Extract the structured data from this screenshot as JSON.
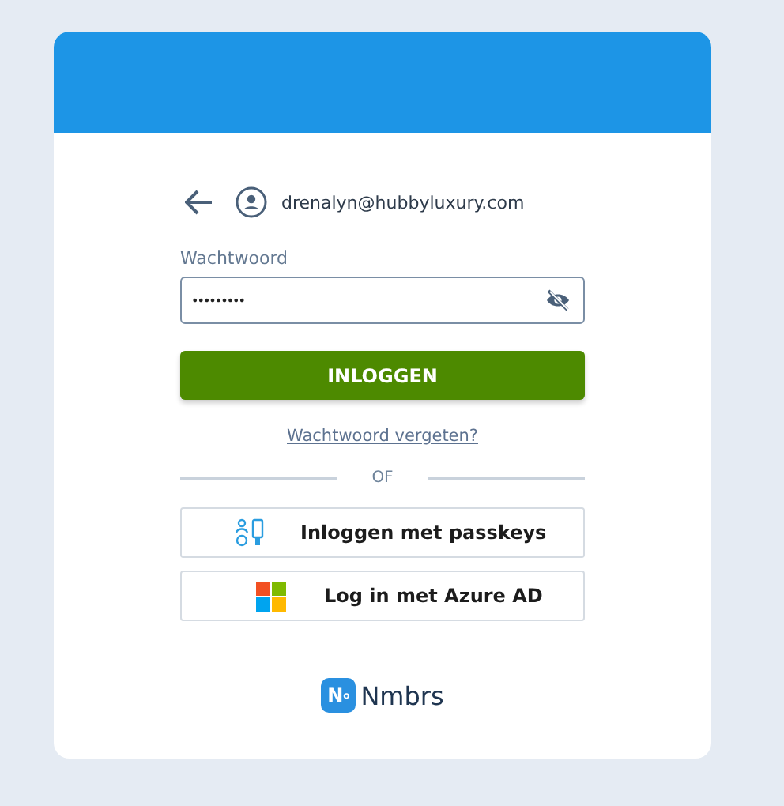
{
  "account": {
    "email": "drenalyn@hubbyluxury.com"
  },
  "password": {
    "label": "Wachtwoord",
    "value": "•••••••••"
  },
  "login_button": "INLOGGEN",
  "forgot_link": "Wachtwoord vergeten?",
  "divider": "OF",
  "alt_logins": [
    {
      "kind": "passkey",
      "label": "Inloggen met passkeys"
    },
    {
      "kind": "microsoft",
      "label": "Log in met Azure AD"
    }
  ],
  "brand": {
    "mark": "N$^{o}$",
    "name": "Nmbrs"
  }
}
